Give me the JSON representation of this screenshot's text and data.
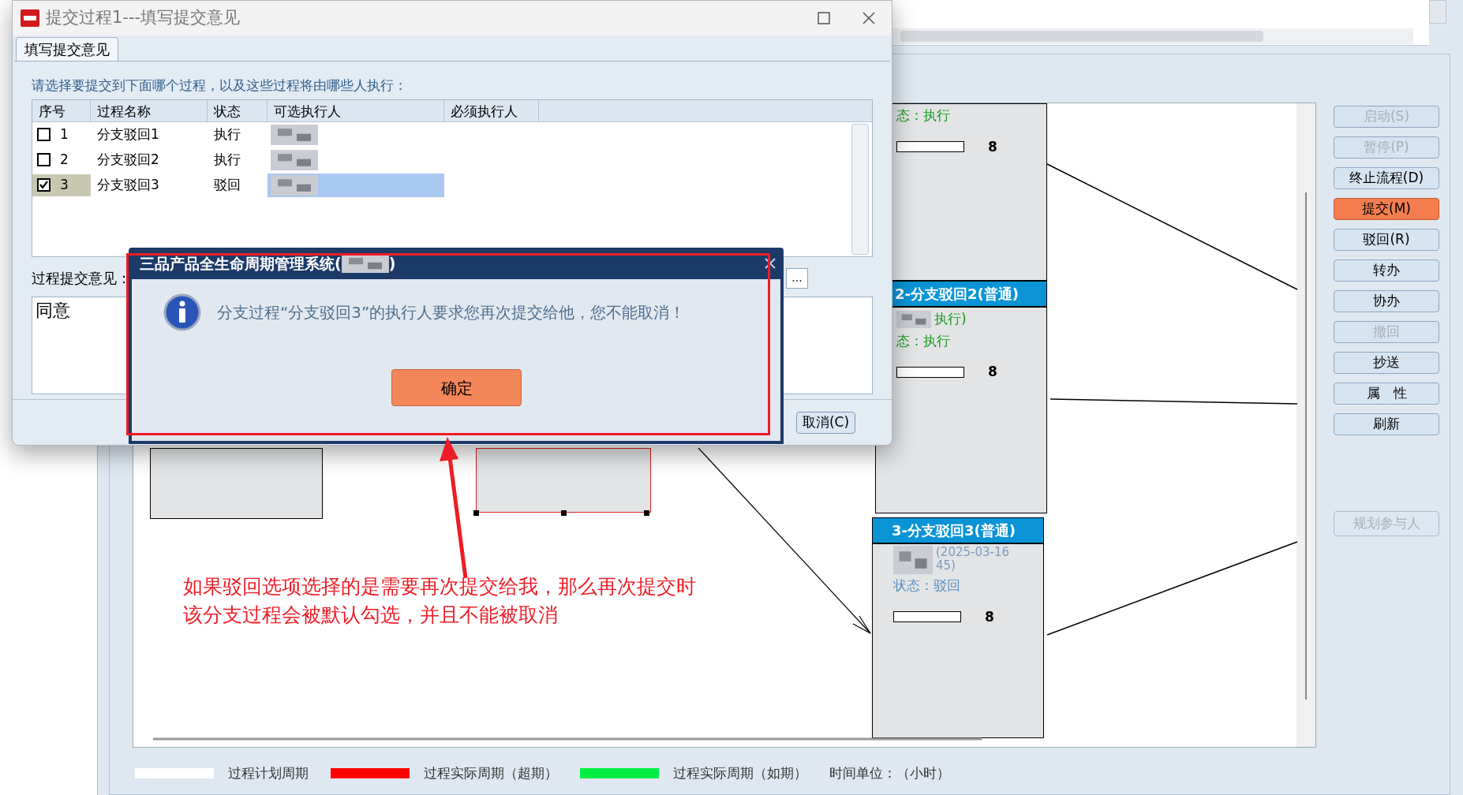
{
  "dialog": {
    "title": "提交过程1---填写提交意见",
    "tabs": [
      {
        "label": "填写提交意见",
        "selected": true
      }
    ],
    "instruction": "请选择要提交到下面哪个过程，以及这些过程将由哪些人执行：",
    "table": {
      "columns": [
        "序号",
        "过程名称",
        "状态",
        "可选执行人",
        "必须执行人"
      ],
      "rows": [
        {
          "index": "1",
          "name": "分支驳回1",
          "status": "执行",
          "checked": false,
          "selected": false
        },
        {
          "index": "2",
          "name": "分支驳回2",
          "status": "执行",
          "checked": false,
          "selected": false
        },
        {
          "index": "3",
          "name": "分支驳回3",
          "status": "驳回",
          "checked": true,
          "selected": true
        }
      ]
    },
    "opinion_label": "过程提交意见：",
    "opinion_value": "同意",
    "more_button": "...",
    "cancel_button": "取消(C)"
  },
  "message_box": {
    "title": "三品产品全生命周期管理系统(",
    "title_end": ")",
    "message": "分支过程“分支驳回3”的执行人要求您再次提交给他，您不能取消！",
    "ok_button": "确定"
  },
  "flow_buttons": [
    {
      "label": "启动(S)",
      "disabled": true,
      "highlighted": false
    },
    {
      "label": "暂停(P)",
      "disabled": true,
      "highlighted": false
    },
    {
      "label": "终止流程(D)",
      "disabled": false,
      "highlighted": false
    },
    {
      "label": "提交(M)",
      "disabled": false,
      "highlighted": true
    },
    {
      "label": "驳回(R)",
      "disabled": false,
      "highlighted": false
    },
    {
      "label": "转办",
      "disabled": false,
      "highlighted": false
    },
    {
      "label": "协办",
      "disabled": false,
      "highlighted": false
    },
    {
      "label": "撤回",
      "disabled": true,
      "highlighted": false
    },
    {
      "label": "抄送",
      "disabled": false,
      "highlighted": false
    },
    {
      "label": "属　性",
      "disabled": false,
      "highlighted": false
    },
    {
      "label": "刷新",
      "disabled": false,
      "highlighted": false
    }
  ],
  "plan_button": {
    "label": "规划参与人",
    "disabled": true
  },
  "nodes": [
    {
      "status": "态：执行",
      "color": "#1a9a1a",
      "hours": "8"
    },
    {
      "header": "2-分支驳回2(普通)",
      "executor": "执行)",
      "status": "态：执行",
      "color": "#1a9a1a",
      "hours": "8"
    },
    {
      "header": "3-分支驳回3(普通)",
      "date": "(2025-03-16",
      "time": "45)",
      "status": "状态：驳回",
      "color": "#5b8fc0",
      "hours": "8"
    }
  ],
  "annotation_lines": [
    "如果驳回选项选择的是需要再次提交给我，那么再次提交时",
    "该分支过程会被默认勾选，并且不能被取消"
  ],
  "legend": [
    {
      "label": "过程计划周期",
      "color": "#ffffff"
    },
    {
      "label": "过程实际周期（超期）",
      "color": "#ff0000"
    },
    {
      "label": "过程实际周期（如期）",
      "color": "#00ee44"
    }
  ],
  "time_unit": "时间单位：（小时）"
}
